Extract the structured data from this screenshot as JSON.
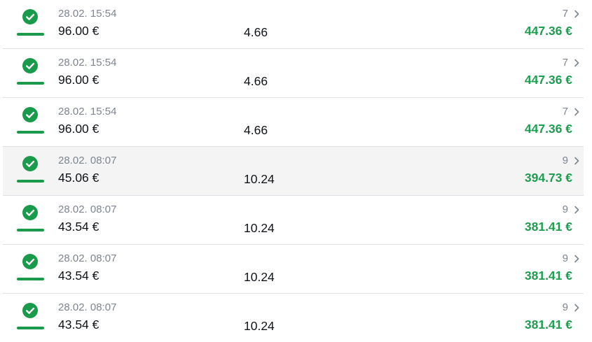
{
  "colors": {
    "success": "#1a9a4b",
    "payout": "#1c9e4f",
    "muted": "#7d8590",
    "text": "#101418",
    "highlight_row": "#f4f4f5"
  },
  "icons": {
    "status": "check-circle-icon",
    "chevron": "chevron-right-icon"
  },
  "bets": [
    {
      "time": "28.02. 15:54",
      "stake": "96.00 €",
      "odds": "4.66",
      "selections": "7",
      "payout": "447.36 €",
      "status": "won"
    },
    {
      "time": "28.02. 15:54",
      "stake": "96.00 €",
      "odds": "4.66",
      "selections": "7",
      "payout": "447.36 €",
      "status": "won"
    },
    {
      "time": "28.02. 15:54",
      "stake": "96.00 €",
      "odds": "4.66",
      "selections": "7",
      "payout": "447.36 €",
      "status": "won"
    },
    {
      "time": "28.02. 08:07",
      "stake": "45.06 €",
      "odds": "10.24",
      "selections": "9",
      "payout": "394.73 €",
      "status": "won",
      "highlighted": true
    },
    {
      "time": "28.02. 08:07",
      "stake": "43.54 €",
      "odds": "10.24",
      "selections": "9",
      "payout": "381.41 €",
      "status": "won"
    },
    {
      "time": "28.02. 08:07",
      "stake": "43.54 €",
      "odds": "10.24",
      "selections": "9",
      "payout": "381.41 €",
      "status": "won"
    },
    {
      "time": "28.02. 08:07",
      "stake": "43.54 €",
      "odds": "10.24",
      "selections": "9",
      "payout": "381.41 €",
      "status": "won"
    }
  ]
}
